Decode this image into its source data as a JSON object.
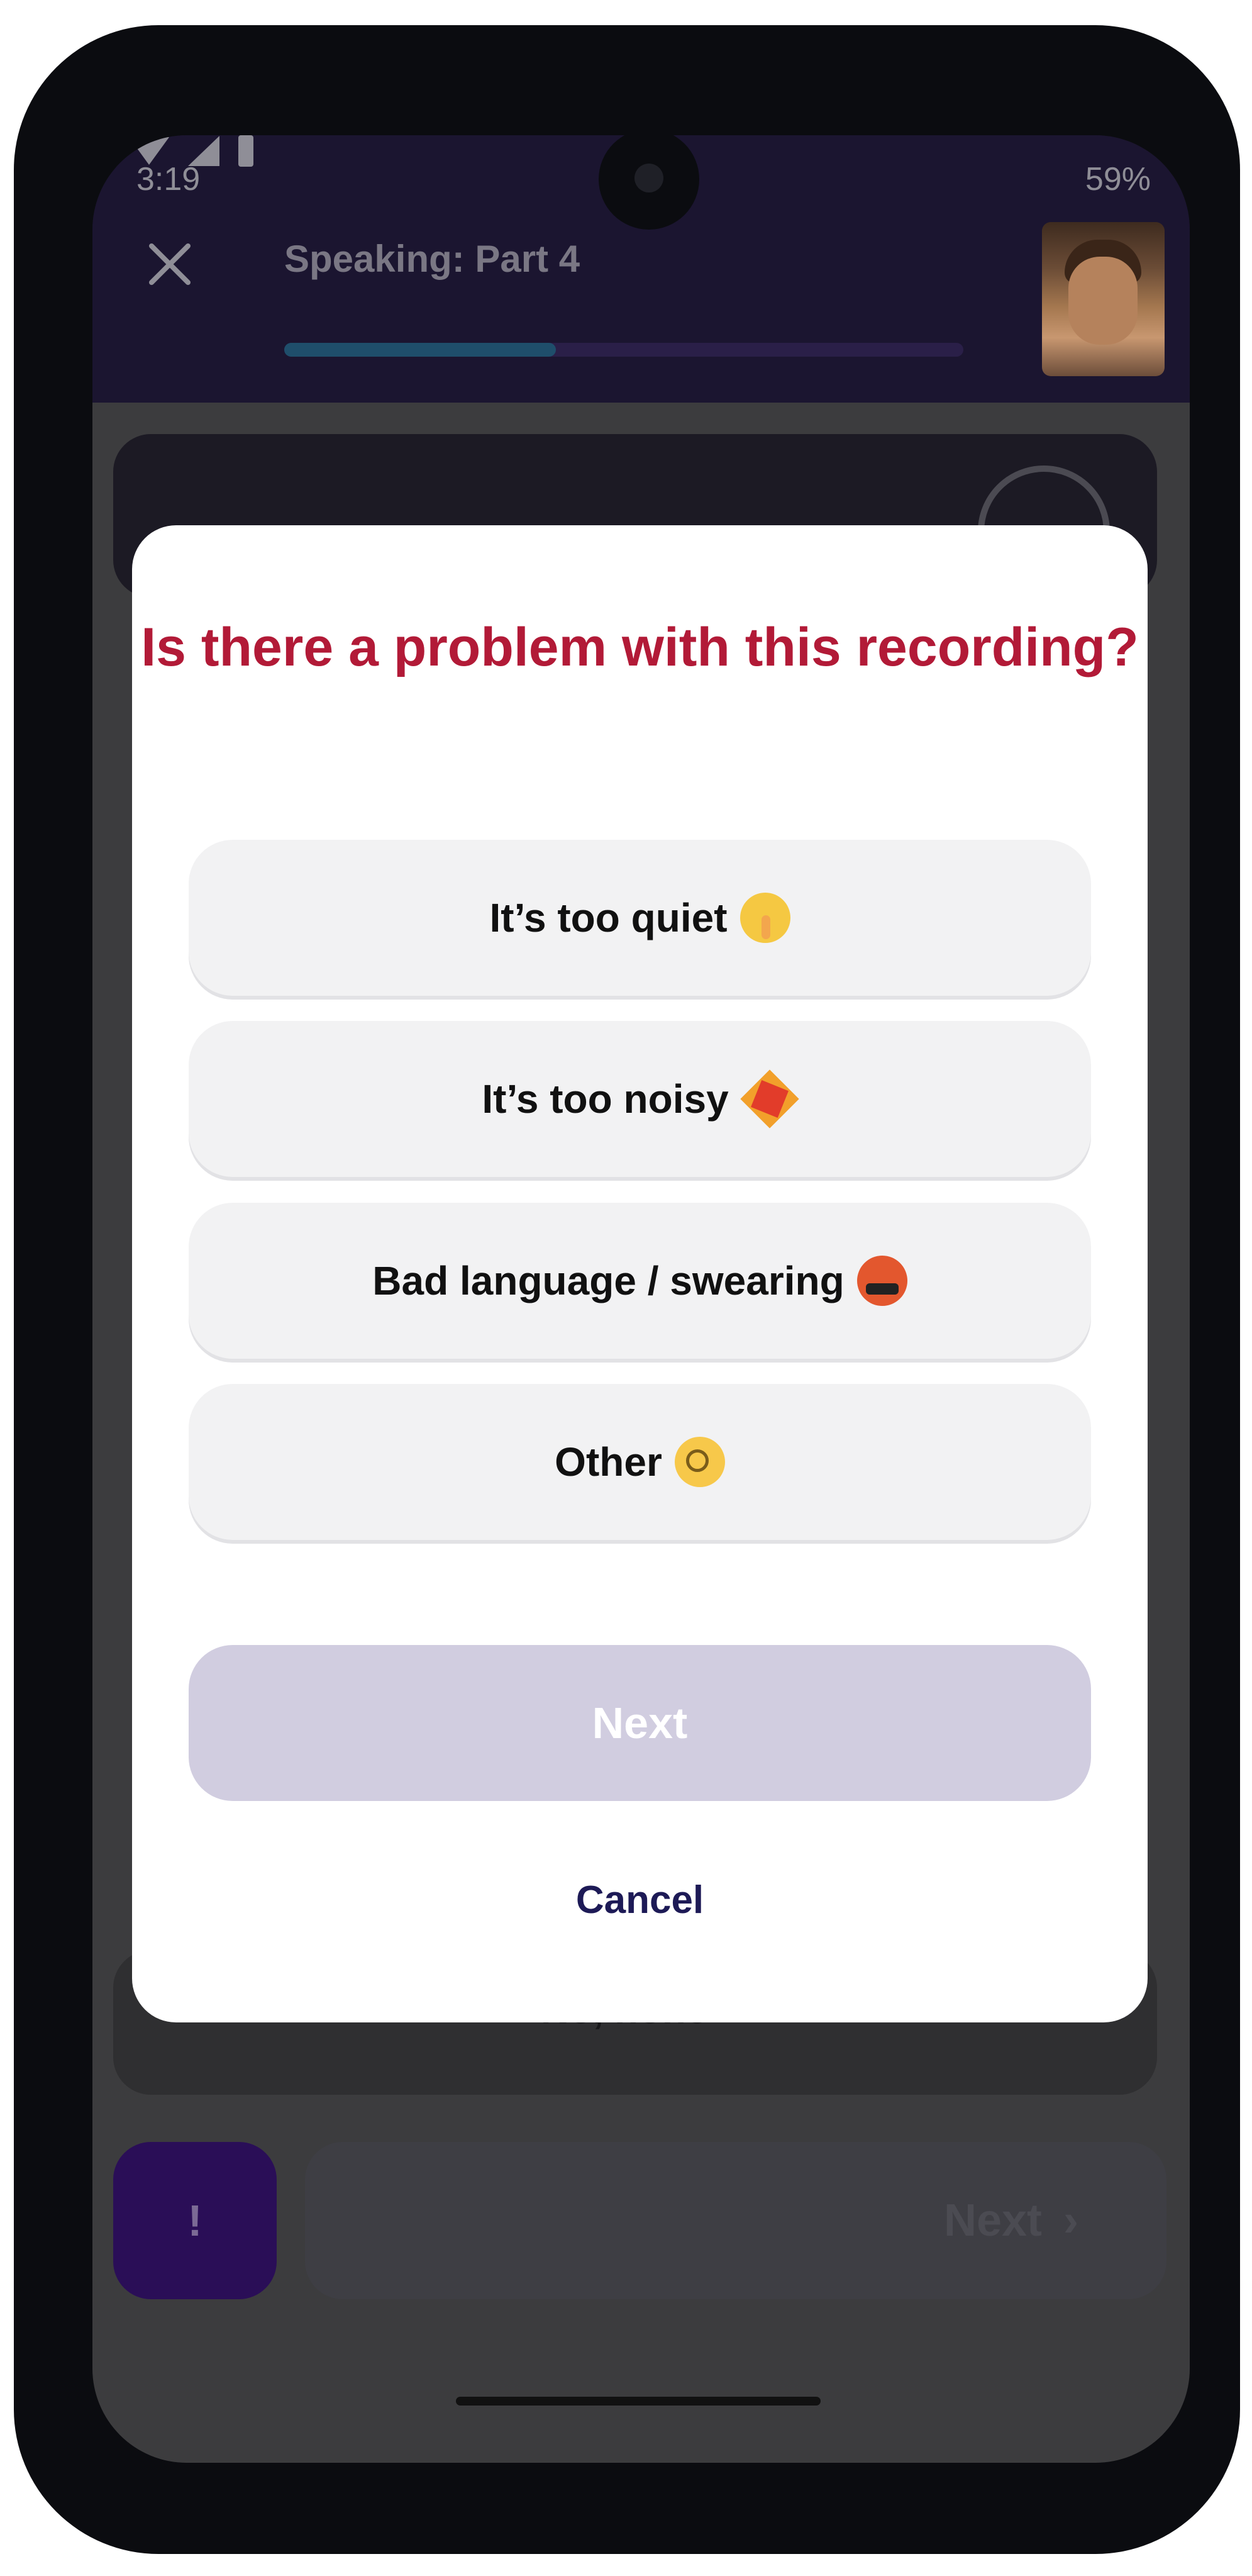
{
  "status_bar": {
    "time": "3:19",
    "battery": "59%"
  },
  "header": {
    "title": "Speaking: Part 4",
    "progress_fraction": 0.4
  },
  "background": {
    "partial_text": "No, none",
    "next_label": "Next",
    "report_label": "!"
  },
  "modal": {
    "title": "Is there a problem with this recording?",
    "options": [
      {
        "label": "It’s too quiet",
        "emoji": "shushing-face"
      },
      {
        "label": "It’s too noisy",
        "emoji": "collision"
      },
      {
        "label": "Bad language / swearing",
        "emoji": "face-with-symbols-on-mouth"
      },
      {
        "label": "Other",
        "emoji": "face-with-monocle"
      }
    ],
    "next_label": "Next",
    "cancel_label": "Cancel"
  },
  "colors": {
    "title_red": "#b21a37",
    "next_disabled": "#d1cde0",
    "cancel": "#1d1a56",
    "progress": "#1f4e6b"
  }
}
